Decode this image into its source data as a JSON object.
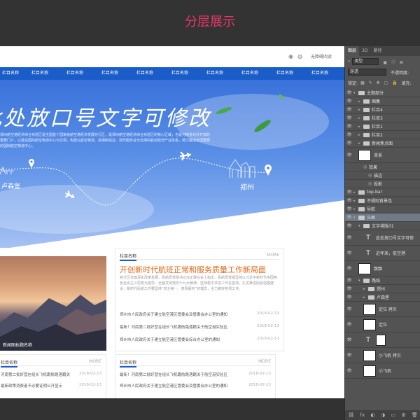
{
  "heading": "分层展示",
  "site": {
    "topbar_link": "无障碍阅读",
    "nav": [
      "栏目名称",
      "栏目名称",
      "栏目名称",
      "栏目名称",
      "栏目名称",
      "栏目名称",
      "栏目名称",
      "栏目名称",
      "栏目名称",
      "栏目名称"
    ],
    "banner_title": "此处放口号文字可修改",
    "banner_desc": "郑州航空港经济综合实验区是全国首个国家级航空港经济发展先行区，是郑州航空港经济综合实验区的核心区域，也是河南省对外开放的重要门户，以建设国际航空物流中心为引领，构建以航空物流、高端制造业、现代服务业为支撑的航空经济产业体系，努力建成全国重要的国际航空物流中心。",
    "city_left": "卢森堡",
    "city_right": "郑州",
    "image_caption": "新闻图标题名称",
    "featured": {
      "tag": "栏目名称",
      "more": "MORE",
      "title": "开创新时代航班正常和服务质量工作新局面",
      "desc": "各分区全面深化改革发展，民航局党组书记冯正霖在会上指出，民航局党组坚持以习近平新时代中国特色社会主义思想为指导，全面贯彻党的十九大精神，坚持稳中求进工作总基调，扎实推进民航强国建设，新时代民航工作要坚持“安全第一、真情服务”的理念，全力做好各项工作。",
      "news": [
        {
          "title": "郑州市人民政府关于建立航空港区管委会及管委会办公室的通知",
          "date": "2018-02-13"
        },
        {
          "title": "最新！河南第二批好营在组长飞机跟航路落籍关于航空港实验区",
          "date": "2018-02-13"
        },
        {
          "title": "郑州市人民政府关于建立航空港区管委会综合办公室的通知",
          "date": "2018-02-13"
        }
      ]
    },
    "left_list": {
      "tag": "栏目名称",
      "more": "MORE",
      "news": [
        {
          "title": "河南第二批好营在组长飞机跟航路落籍关于航空港实验区",
          "date": "2018-02-13"
        },
        {
          "title": "最新政策消费者不必要证明公开显示",
          "date": "2018-02-13"
        }
      ]
    },
    "right_list": {
      "tag": "栏目名称",
      "more": "MORE",
      "news": [
        {
          "title": "最新！河南第二批好营在组长飞机跟航路落籍关于航空港实验区",
          "date": "2018-02-13"
        },
        {
          "title": "郑州市人民政府关于建立航空港区管委会及管委会办公室的通知",
          "date": "2018-02-13"
        }
      ]
    }
  },
  "ps": {
    "tabs": [
      "图层",
      "3D",
      "路径"
    ],
    "kind": "类型",
    "blend": "穿透",
    "opacity_label": "不透明度:",
    "lock_label": "锁定:",
    "fill_label": "填充:",
    "layers": [
      {
        "name": "主题部分",
        "type": "folder",
        "indent": 0,
        "open": true
      },
      {
        "name": "图集",
        "type": "folder",
        "indent": 1
      },
      {
        "name": "栏目4",
        "type": "folder",
        "indent": 1
      },
      {
        "name": "栏目3",
        "type": "folder",
        "indent": 1
      },
      {
        "name": "栏目1",
        "type": "folder",
        "indent": 1
      },
      {
        "name": "栏目2",
        "type": "folder",
        "indent": 1
      },
      {
        "name": "新闻焦点图",
        "type": "folder",
        "indent": 1
      },
      {
        "name": "背景",
        "type": "thumb",
        "indent": 1
      },
      {
        "name": "效果",
        "type": "effect",
        "indent": 2
      },
      {
        "name": "描边",
        "type": "effect",
        "indent": 3
      },
      {
        "name": "投影",
        "type": "effect",
        "indent": 3
      },
      {
        "name": "top-bar",
        "type": "folder",
        "indent": 0
      },
      {
        "name": "不规则背景色",
        "type": "folder",
        "indent": 0
      },
      {
        "name": "导航",
        "type": "folder",
        "indent": 0
      },
      {
        "name": "头图",
        "type": "folder",
        "indent": 0,
        "open": true,
        "selected": true
      },
      {
        "name": "文字排版01",
        "type": "folder",
        "indent": 1,
        "open": true
      },
      {
        "name": "此处放口号文字可修",
        "type": "text",
        "indent": 2
      },
      {
        "name": "近年来，航空港",
        "type": "text",
        "indent": 2
      },
      {
        "name": "飘飘",
        "type": "thumb",
        "indent": 1
      },
      {
        "name": "路线",
        "type": "folder",
        "indent": 1,
        "open": true
      },
      {
        "name": "郑州",
        "type": "folder",
        "indent": 2
      },
      {
        "name": "卢森堡",
        "type": "folder",
        "indent": 2
      },
      {
        "name": "定位 拷贝",
        "type": "thumb",
        "indent": 2
      },
      {
        "name": "定位",
        "type": "thumb",
        "indent": 2
      },
      {
        "name": "",
        "type": "text-mask",
        "indent": 2
      },
      {
        "name": "小飞机 拷贝",
        "type": "thumb",
        "indent": 2
      },
      {
        "name": "小飞机",
        "type": "thumb",
        "indent": 2
      }
    ]
  }
}
